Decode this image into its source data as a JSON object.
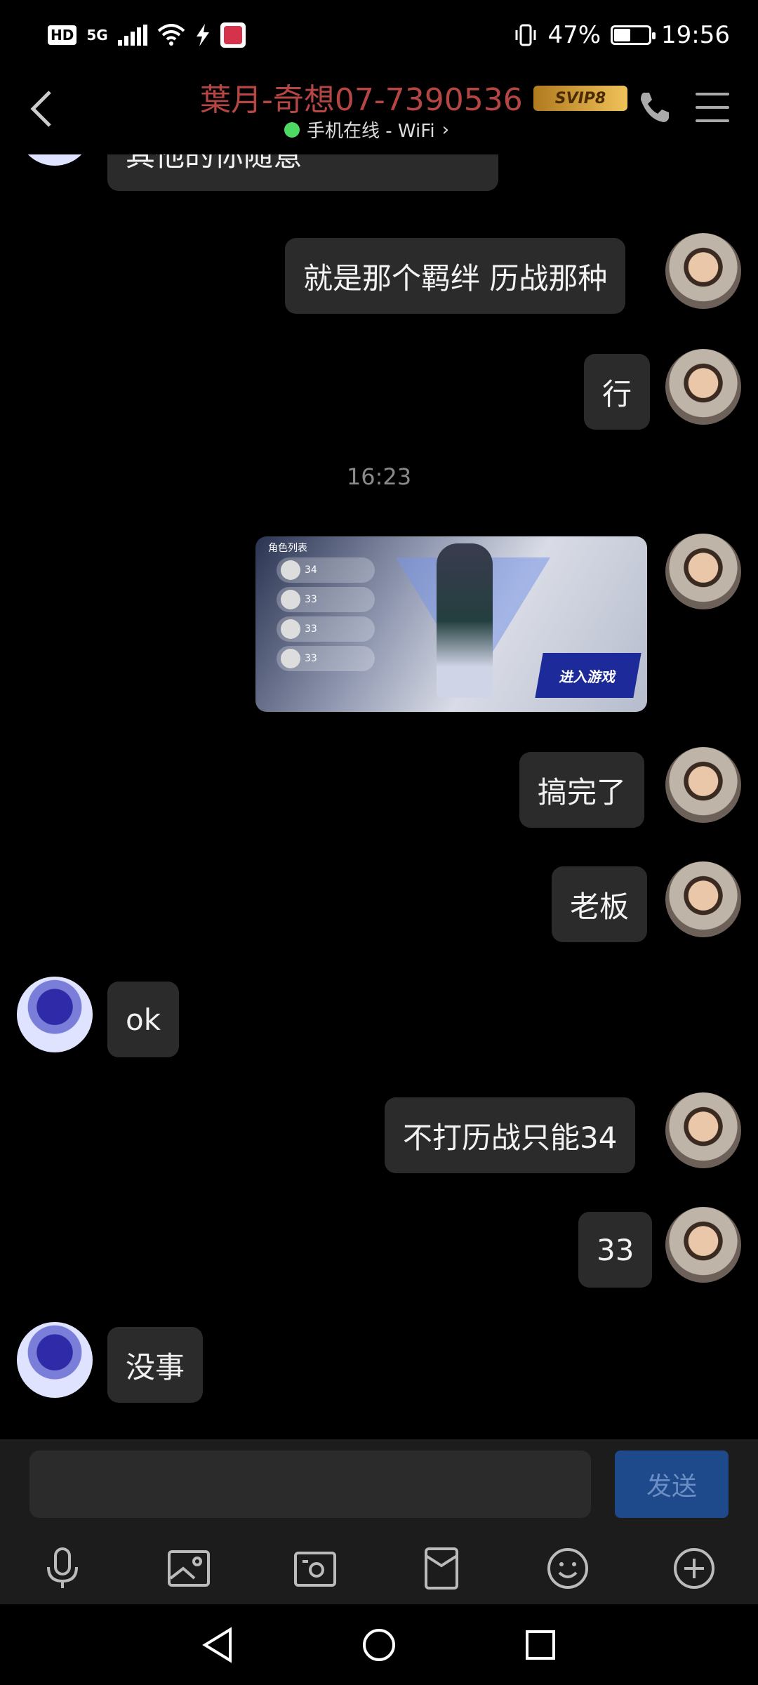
{
  "status_bar": {
    "hd": "HD",
    "network": "5G",
    "battery_text": "47%",
    "battery_level": 0.47,
    "time": "19:56"
  },
  "header": {
    "title": "葉月-奇想07-7390536",
    "badge": "SVIP8",
    "subtitle": "手机在线 - WiFi",
    "online_color": "#4cd964",
    "title_color": "#b64643"
  },
  "messages": [
    {
      "from": "them",
      "text": "其他的你随意"
    },
    {
      "from": "me",
      "text": "就是那个羁绊 历战那种"
    },
    {
      "from": "me",
      "text": "行"
    },
    {
      "timestamp": "16:23"
    },
    {
      "from": "me",
      "image": {
        "tag": "角色列表",
        "rows": [
          "34",
          "33",
          "33",
          "33"
        ],
        "button": "进入游戏"
      }
    },
    {
      "from": "me",
      "text": "搞完了"
    },
    {
      "from": "me",
      "text": "老板"
    },
    {
      "from": "them",
      "text": "ok"
    },
    {
      "from": "me",
      "text": "不打历战只能34"
    },
    {
      "from": "me",
      "text": "33"
    },
    {
      "from": "them",
      "text": "没事"
    }
  ],
  "input": {
    "placeholder": "",
    "send_label": "发送",
    "send_color": "#1e4a8c"
  },
  "toolbar": [
    "microphone-icon",
    "gallery-icon",
    "camera-icon",
    "file-icon",
    "emoji-icon",
    "plus-icon"
  ],
  "navbar": [
    "back-triangle-icon",
    "home-circle-icon",
    "recents-square-icon"
  ]
}
